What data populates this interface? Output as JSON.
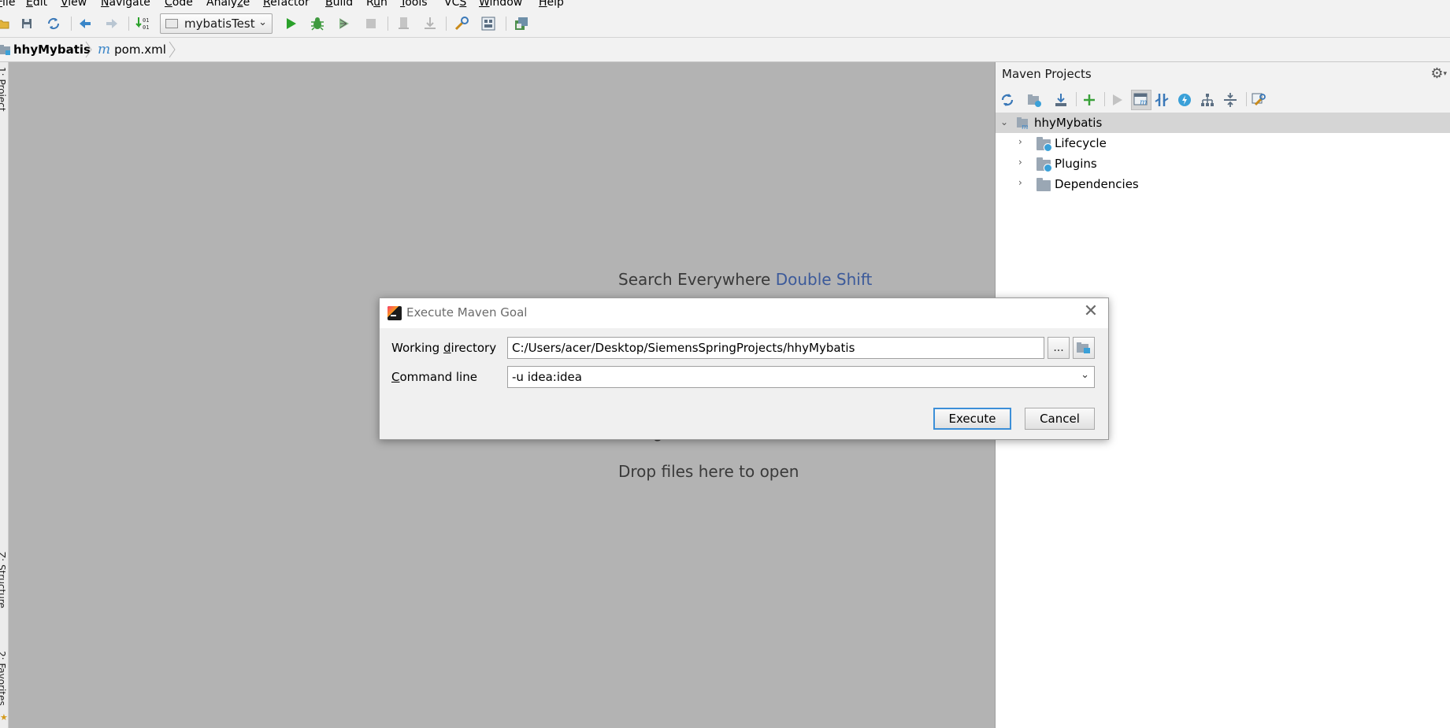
{
  "menu": {
    "items": [
      {
        "pre": "",
        "u": "F",
        "post": "ile"
      },
      {
        "pre": "",
        "u": "E",
        "post": "dit"
      },
      {
        "pre": "",
        "u": "V",
        "post": "iew"
      },
      {
        "pre": "",
        "u": "N",
        "post": "avigate"
      },
      {
        "pre": "",
        "u": "C",
        "post": "ode"
      },
      {
        "pre": "Analy",
        "u": "z",
        "post": "e"
      },
      {
        "pre": "",
        "u": "R",
        "post": "efactor"
      },
      {
        "pre": "",
        "u": "B",
        "post": "uild"
      },
      {
        "pre": "R",
        "u": "u",
        "post": "n"
      },
      {
        "pre": "",
        "u": "T",
        "post": "ools"
      },
      {
        "pre": "VC",
        "u": "S",
        "post": ""
      },
      {
        "pre": "",
        "u": "W",
        "post": "indow"
      },
      {
        "pre": "",
        "u": "H",
        "post": "elp"
      }
    ]
  },
  "toolbar": {
    "run_config": "mybatisTest"
  },
  "navbar": {
    "project": "hhyMybatis",
    "file": "pom.xml"
  },
  "left_strip": {
    "project_tab": "1: Project",
    "structure_tab": "Z: Structure",
    "favorites_tab": "2: Favorites"
  },
  "editor": {
    "search_hint": "Search Everywhere",
    "search_key": "Double Shift",
    "navbar_hint_partial": "g",
    "drop_hint": "Drop files here to open"
  },
  "maven": {
    "title": "Maven Projects",
    "root": "hhyMybatis",
    "children": [
      "Lifecycle",
      "Plugins",
      "Dependencies"
    ]
  },
  "dialog": {
    "title": "Execute Maven Goal",
    "working_dir_label_pre": "Working ",
    "working_dir_label_u": "d",
    "working_dir_label_post": "irectory",
    "working_dir_value": "C:/Users/acer/Desktop/SiemensSpringProjects/hhyMybatis",
    "browse_label": "...",
    "command_label_u": "C",
    "command_label_post": "ommand line",
    "command_value": "-u idea:idea",
    "execute_label": "Execute",
    "cancel_label": "Cancel"
  },
  "colors": {
    "editor_bg": "#b3b3b3",
    "link_blue": "#3c5a9a",
    "default_button_border": "#3c8fd8",
    "run_green": "#2aa12a"
  }
}
